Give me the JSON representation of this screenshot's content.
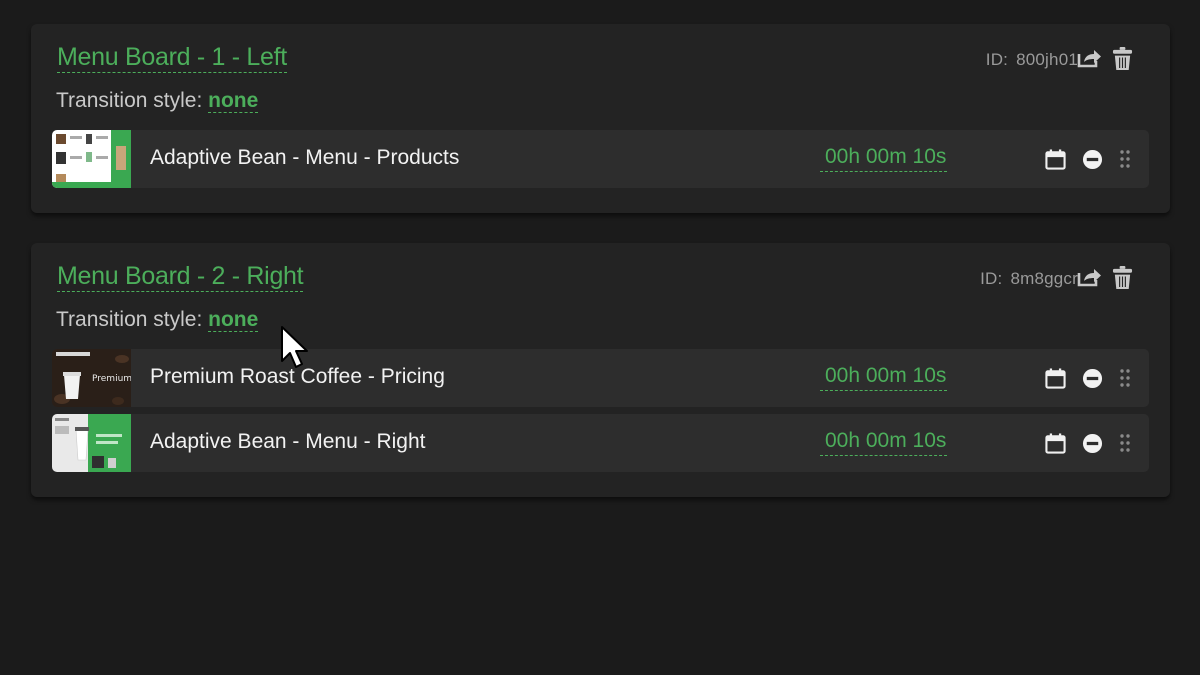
{
  "colors": {
    "accent": "#4cae5b",
    "card": "#232323",
    "row": "#2d2d2d",
    "background": "#1b1b1b"
  },
  "boards": [
    {
      "title": "Menu Board - 1 - Left",
      "transition_label": "Transition style:",
      "transition_value": "none",
      "id_label": "ID:",
      "id_value": "800jh01",
      "items": [
        {
          "name": "Adaptive Bean - Menu - Products",
          "duration": "00h 00m 10s"
        }
      ]
    },
    {
      "title": "Menu Board - 2 - Right",
      "transition_label": "Transition style:",
      "transition_value": "none",
      "id_label": "ID:",
      "id_value": "8m8ggcr",
      "items": [
        {
          "name": "Premium Roast Coffee - Pricing",
          "duration": "00h 00m 10s",
          "thumb_text": "Premium Roast"
        },
        {
          "name": "Adaptive Bean - Menu - Right",
          "duration": "00h 00m 10s"
        }
      ]
    }
  ],
  "icons": {
    "share": "share-icon",
    "trash": "trash-icon",
    "calendar": "calendar-icon",
    "remove": "remove-icon",
    "drag": "drag-handle-icon"
  }
}
